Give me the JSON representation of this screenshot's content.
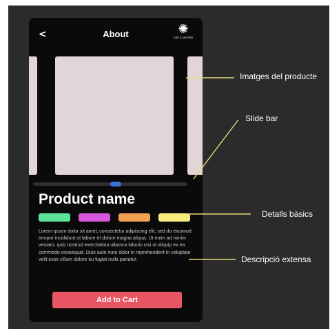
{
  "header": {
    "back_label": "<",
    "title": "About",
    "wishlist_label": "Add to wishlist"
  },
  "gallery": {
    "images": [
      "previous-image",
      "main-image",
      "next-image"
    ],
    "slider_position": 0.5
  },
  "product": {
    "name": "Product name",
    "swatches": [
      "#5be398",
      "#d656de",
      "#f2a053",
      "#f5ee7c"
    ],
    "description": "Lorem ipsum dolor sit amet, consectetur adipiscing elit, sed do eiusmod tempor incididunt ut labore et dolore magna aliqua. Ut enim ad minim veniam, quis nostrud exercitation ullamco laboris nisi ut aliquip ex ea commodo consequat. Duis aute irure dolor in reprehenderit in voluptate velit esse cillum dolore eu fugiat nulla pariatur.",
    "cta_label": "Add to Cart",
    "cta_color": "#e85664"
  },
  "annotations": {
    "images": "Imatges del producte",
    "slider": "Slide bar",
    "details": "Detalls bàsics",
    "description": "Descripció extensa",
    "line_color": "#e6d97a"
  },
  "colors": {
    "canvas": "#2b2b2b",
    "phone": "#0a0a0a",
    "image_placeholder": "#e2d5d8",
    "slider_thumb": "#3e74d8"
  }
}
